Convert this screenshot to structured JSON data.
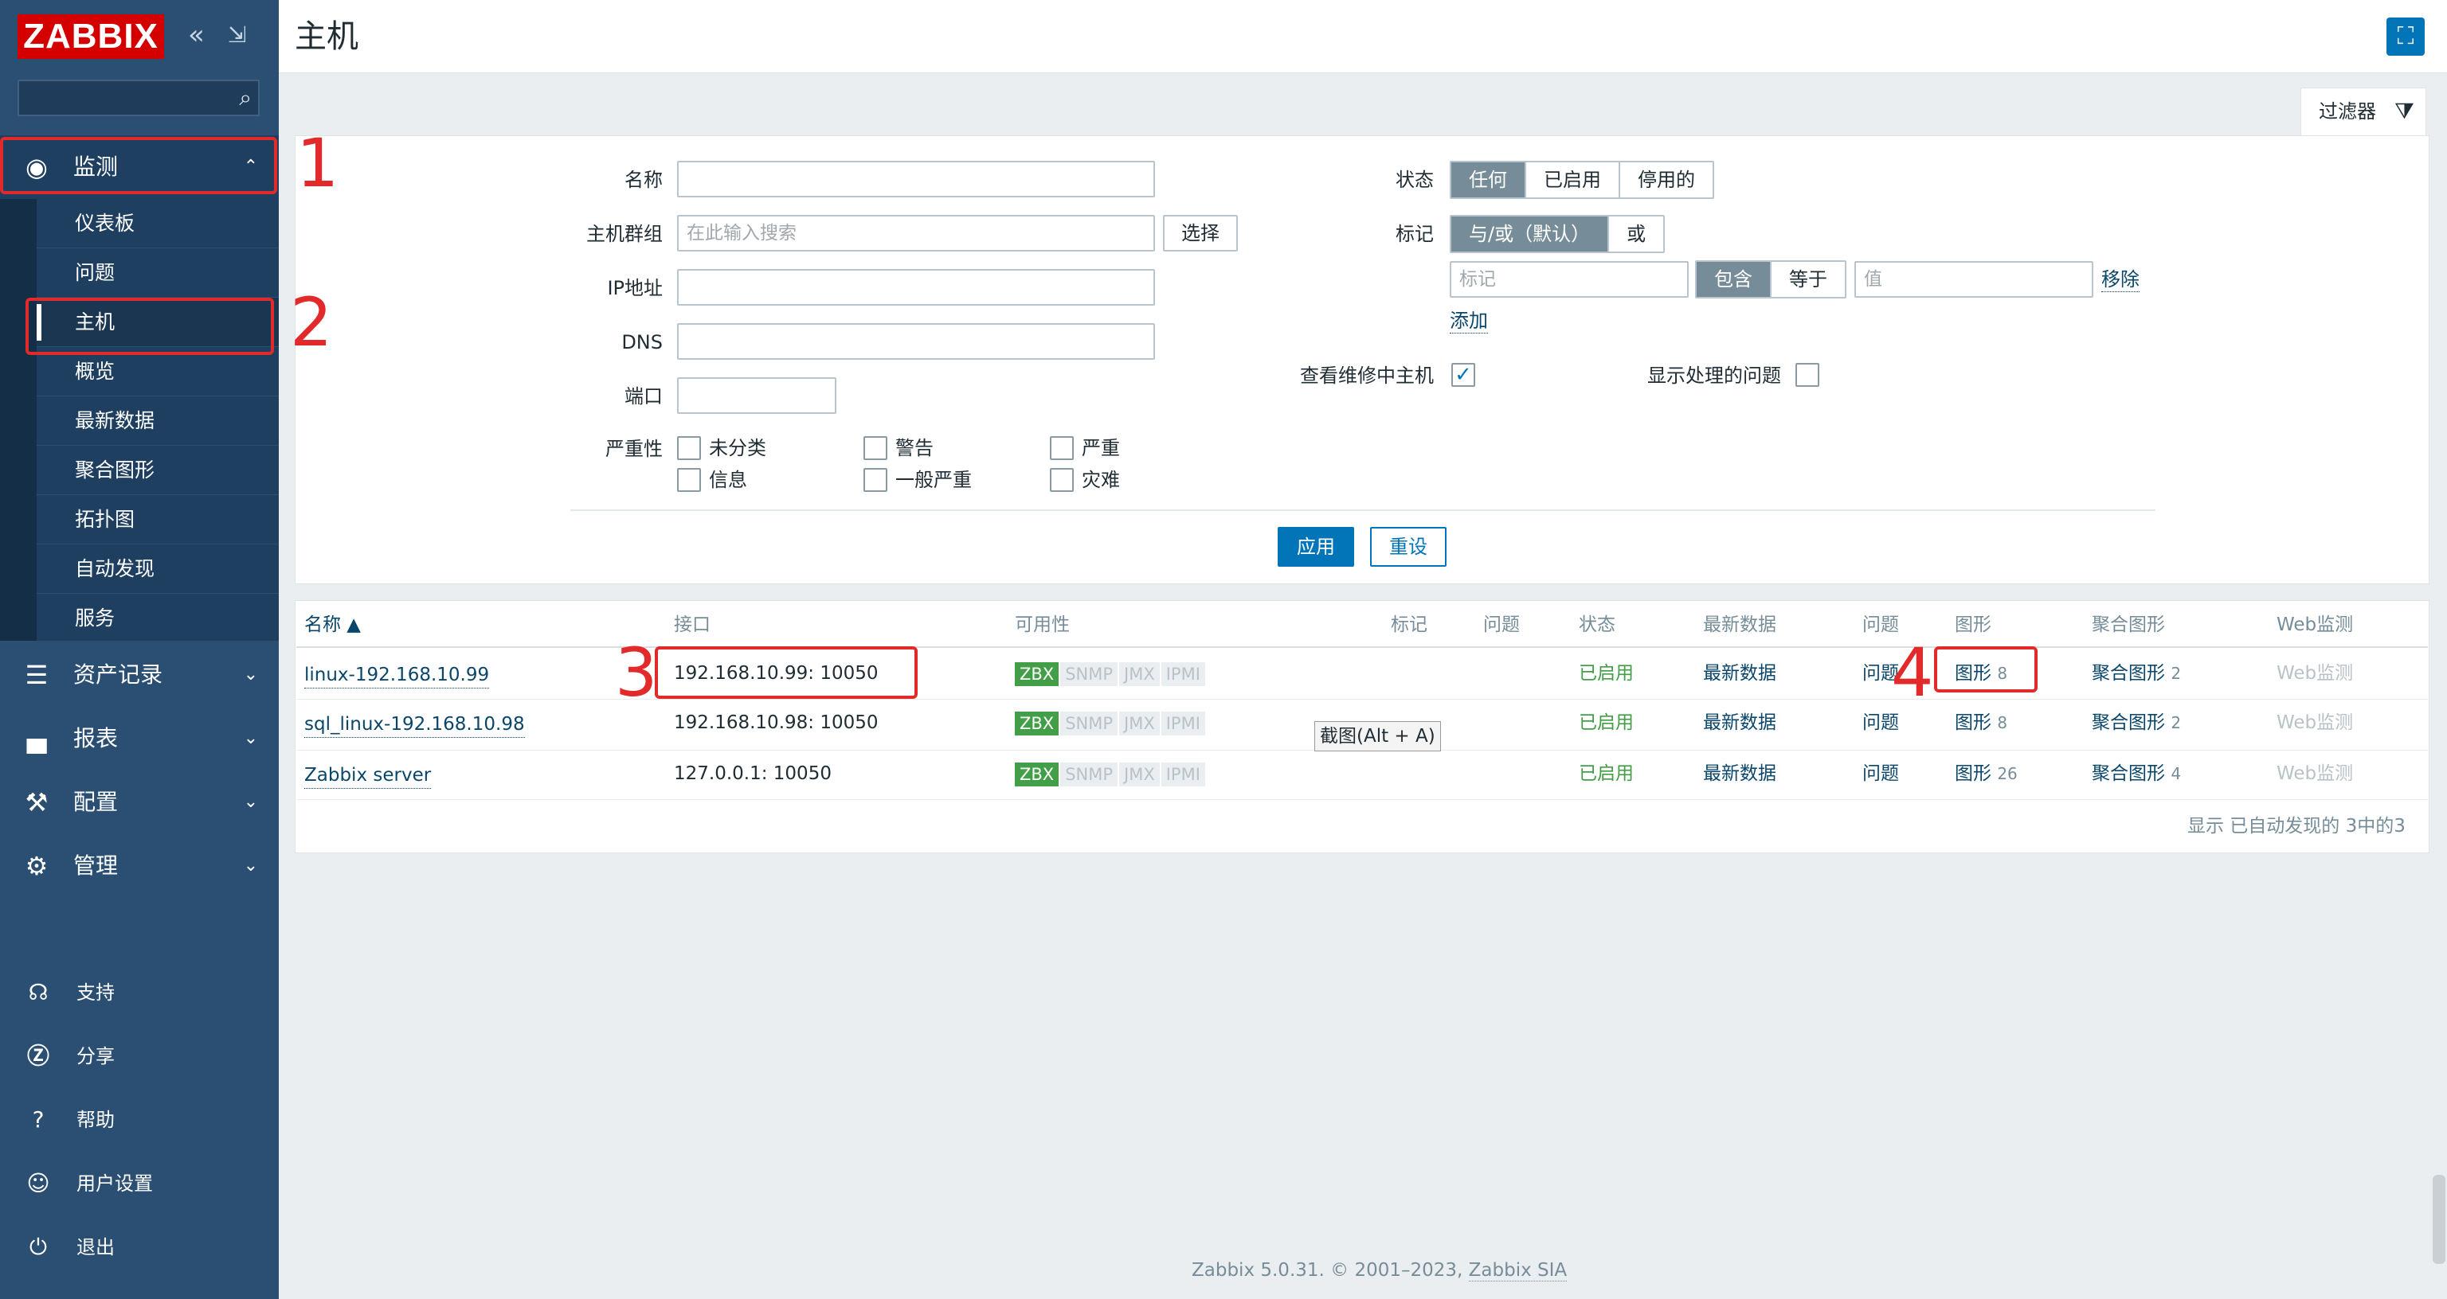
{
  "app": {
    "logo": "ZABBIX"
  },
  "sidebar": {
    "collapse_icon": "«",
    "detach_icon": "⇲",
    "search_placeholder": "",
    "monitoring": {
      "label": "监测",
      "icon": "eye-icon"
    },
    "submenu": [
      "仪表板",
      "问题",
      "主机",
      "概览",
      "最新数据",
      "聚合图形",
      "拓扑图",
      "自动发现",
      "服务"
    ],
    "active_submenu": "主机",
    "sections": [
      {
        "label": "资产记录",
        "icon": "list-icon"
      },
      {
        "label": "报表",
        "icon": "bar-chart-icon"
      },
      {
        "label": "配置",
        "icon": "wrench-icon"
      },
      {
        "label": "管理",
        "icon": "gear-icon"
      }
    ],
    "bottom": [
      {
        "label": "支持",
        "icon": "headset-icon"
      },
      {
        "label": "分享",
        "icon": "share-icon"
      },
      {
        "label": "帮助",
        "icon": "help-icon"
      },
      {
        "label": "用户设置",
        "icon": "user-icon"
      },
      {
        "label": "退出",
        "icon": "power-icon"
      }
    ]
  },
  "header": {
    "title": "主机",
    "fullscreen_icon": "fullscreen-icon"
  },
  "filter": {
    "tab_label": "过滤器",
    "name_label": "名称",
    "name_value": "",
    "hostgroup_label": "主机群组",
    "hostgroup_placeholder": "在此输入搜索",
    "select_button": "选择",
    "ip_label": "IP地址",
    "ip_value": "",
    "dns_label": "DNS",
    "dns_value": "",
    "port_label": "端口",
    "port_value": "",
    "severity_label": "严重性",
    "severities": [
      "未分类",
      "信息",
      "警告",
      "一般严重",
      "严重",
      "灾难"
    ],
    "status_label": "状态",
    "status_options": [
      "任何",
      "已启用",
      "停用的"
    ],
    "status_selected": "任何",
    "tags_label": "标记",
    "tag_op_options": [
      "与/或（默认）",
      "或"
    ],
    "tag_placeholder": "标记",
    "tag_match_options": [
      "包含",
      "等于"
    ],
    "value_placeholder": "值",
    "remove_link": "移除",
    "add_link": "添加",
    "maintenance_label": "查看维修中主机",
    "maintenance_checked": true,
    "suppressed_label": "显示处理的问题",
    "suppressed_checked": false,
    "apply": "应用",
    "reset": "重设"
  },
  "table": {
    "headers": [
      "名称 ▲",
      "接口",
      "可用性",
      "标记",
      "问题",
      "状态",
      "最新数据",
      "问题",
      "图形",
      "聚合图形",
      "Web监测"
    ],
    "rows": [
      {
        "name": "linux-192.168.10.99",
        "interface": "192.168.10.99: 10050",
        "status": "已启用",
        "latest": "最新数据",
        "problems": "问题",
        "graphs": "图形",
        "graphs_count": "8",
        "screens": "聚合图形",
        "screens_count": "2",
        "web": "Web监测"
      },
      {
        "name": "sql_linux-192.168.10.98",
        "interface": "192.168.10.98: 10050",
        "status": "已启用",
        "latest": "最新数据",
        "problems": "问题",
        "graphs": "图形",
        "graphs_count": "8",
        "screens": "聚合图形",
        "screens_count": "2",
        "web": "Web监测"
      },
      {
        "name": "Zabbix server",
        "interface": "127.0.0.1: 10050",
        "status": "已启用",
        "latest": "最新数据",
        "problems": "问题",
        "graphs": "图形",
        "graphs_count": "26",
        "screens": "聚合图形",
        "screens_count": "4",
        "web": "Web监测"
      }
    ],
    "availability_labels": [
      "ZBX",
      "SNMP",
      "JMX",
      "IPMI"
    ],
    "footer": "显示 已自动发现的 3中的3"
  },
  "tooltip": "截图(Alt + A)",
  "footer": {
    "text": "Zabbix 5.0.31. © 2001–2023, ",
    "link": "Zabbix SIA"
  },
  "annotations": [
    "1",
    "2",
    "3",
    "4"
  ],
  "colors": {
    "sidebar": "#2b4e73",
    "accent": "#0275b8",
    "green": "#429e47",
    "annotation": "#e32a2a",
    "logo": "#d40000"
  }
}
